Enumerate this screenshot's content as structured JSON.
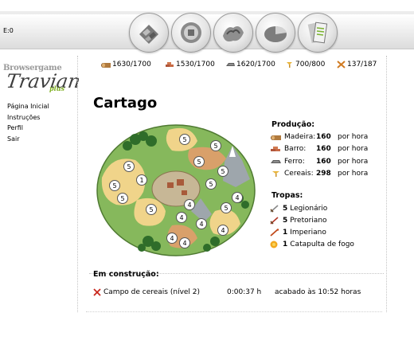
{
  "server": "E:0",
  "logo": {
    "line1": "Browsergame",
    "line2": "Travian",
    "line3": "plus"
  },
  "nav_icons": [
    "village-overview-icon",
    "village-center-icon",
    "map-icon",
    "statistics-icon",
    "reports-icon"
  ],
  "menu": [
    "Página Inicial",
    "Instruções",
    "Perfil",
    "Sair"
  ],
  "resources": [
    {
      "icon": "wood-icon",
      "value": "1630/1700"
    },
    {
      "icon": "clay-icon",
      "value": "1530/1700"
    },
    {
      "icon": "iron-icon",
      "value": "1620/1700"
    },
    {
      "icon": "crop-icon",
      "value": "700/800"
    },
    {
      "icon": "consumption-icon",
      "value": "137/187"
    }
  ],
  "village_name": "Cartago",
  "production": {
    "title": "Produção:",
    "unit": "por hora",
    "items": [
      {
        "icon": "wood-icon",
        "name": "Madeira:",
        "value": "160"
      },
      {
        "icon": "clay-icon",
        "name": "Barro:",
        "value": "160"
      },
      {
        "icon": "iron-icon",
        "name": "Ferro:",
        "value": "160"
      },
      {
        "icon": "crop-icon",
        "name": "Cereais:",
        "value": "298"
      }
    ]
  },
  "troops": {
    "title": "Tropas:",
    "items": [
      {
        "icon": "legionnaire-icon",
        "count": "5",
        "name": "Legionário"
      },
      {
        "icon": "praetorian-icon",
        "count": "5",
        "name": "Pretoriano"
      },
      {
        "icon": "imperian-icon",
        "count": "1",
        "name": "Imperiano"
      },
      {
        "icon": "fire-catapult-icon",
        "count": "1",
        "name": "Catapulta de fogo"
      }
    ]
  },
  "construction": {
    "title": "Em construção:",
    "item": "Campo de cereais (nível 2)",
    "time": "0:00:37 h",
    "finish": "acabado às 10:52 horas"
  },
  "map_field_levels": [
    "5",
    "5",
    "5",
    "5",
    "1",
    "5",
    "5",
    "5",
    "5",
    "5",
    "4",
    "5",
    "4",
    "4",
    "4",
    "4",
    "4",
    "4"
  ]
}
